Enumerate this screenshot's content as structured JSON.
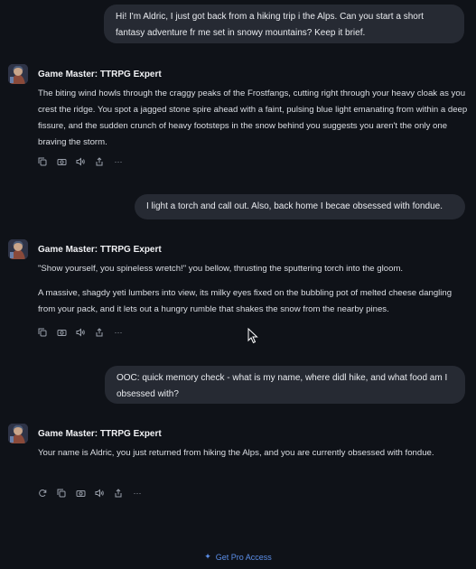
{
  "conversation": {
    "user_messages": [
      "Hi! I'm Aldric, I just got back from a hiking trip i the Alps. Can you start a short fantasy adventure fr me set in snowy mountains? Keep it brief.",
      "I light a torch and call out. Also, back home I becae obsessed with fondue.",
      "OOC: quick memory check - what is my name, where didl hike, and what food am I obsessed with?"
    ],
    "assistant_name": "Game Master: TTRPG Expert",
    "assistant_messages": [
      "The biting wind howls through the craggy peaks of the Frostfangs, cutting right through your heavy cloak as you crest the ridge. You spot a jagged stone spire ahead with a faint, pulsing blue light emanating from within a deep fissure, and the sudden crunch of heavy footsteps in the snow behind you suggests you aren't the only one braving the storm.",
      "\"Show yourself, you spineless wretch!\" you bellow, thrusting the sputtering torch into the gloom.",
      "A massive, shagdy yeti lumbers into view, its milky eyes fixed on the bubbling pot of melted cheese dangling from your pack, and it lets out a hungry rumble that shakes the snow from the nearby pines.",
      "Your name is Aldric, you just returned from hiking the Alps, and you are currently obsessed with fondue."
    ]
  },
  "actions": {
    "more_glyph": "···"
  },
  "footer": {
    "pro_label": "Get Pro Access",
    "pro_icon": "✦"
  },
  "colors": {
    "background": "#0f1218",
    "user_bubble": "#262a33",
    "accent_link": "#5b8ee8"
  }
}
